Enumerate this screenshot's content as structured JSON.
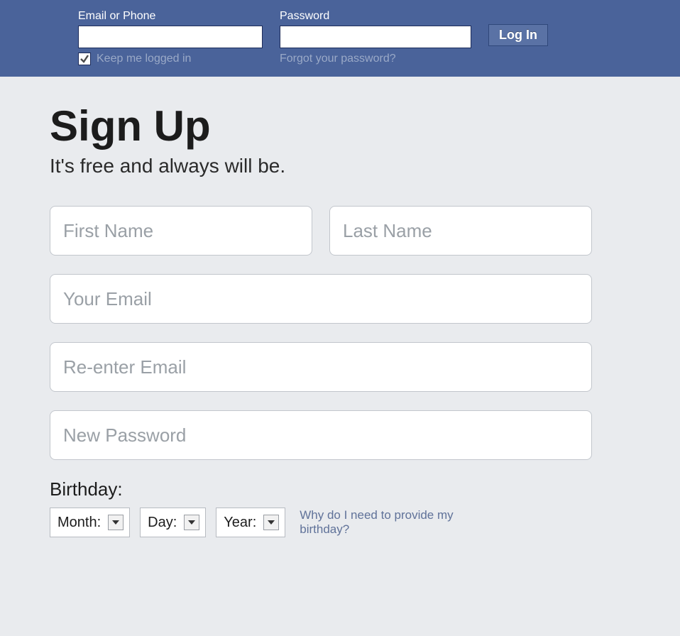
{
  "header": {
    "email_label": "Email or Phone",
    "password_label": "Password",
    "keep_logged": "Keep me logged in",
    "forgot": "Forgot your password?",
    "login_btn": "Log In"
  },
  "signup": {
    "title": "Sign Up",
    "subtitle": "It's free and always will be.",
    "first_name_ph": "First Name",
    "last_name_ph": "Last Name",
    "email_ph": "Your Email",
    "reemail_ph": "Re-enter Email",
    "password_ph": "New Password",
    "birthday_label": "Birthday:",
    "month": "Month:",
    "day": "Day:",
    "year": "Year:",
    "why_birthday": "Why do I need to provide my birthday?"
  }
}
